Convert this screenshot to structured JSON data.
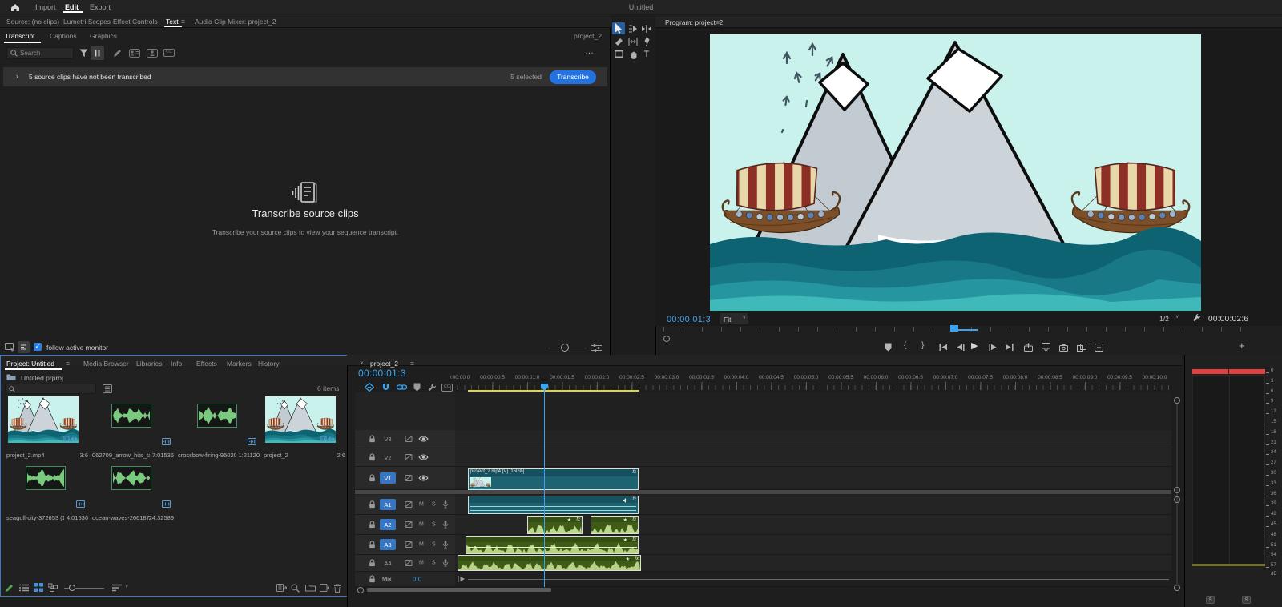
{
  "topbar": {
    "title": "Untitled",
    "tabs": [
      {
        "label": "Import",
        "active": false
      },
      {
        "label": "Edit",
        "active": true
      },
      {
        "label": "Export",
        "active": false
      }
    ]
  },
  "panel_tabs": [
    {
      "label": "Source: (no clips)",
      "active": false
    },
    {
      "label": "Lumetri Scopes",
      "active": false
    },
    {
      "label": "Effect Controls",
      "active": false
    },
    {
      "label": "Text",
      "active": true
    },
    {
      "label": "Audio Clip Mixer: project_2",
      "active": false
    }
  ],
  "text_panel": {
    "tabs": [
      {
        "label": "Transcript",
        "active": true
      },
      {
        "label": "Captions",
        "active": false
      },
      {
        "label": "Graphics",
        "active": false
      }
    ],
    "sequence_label": "project_2",
    "search_placeholder": "Search",
    "banner": {
      "message": "5 source clips have not been transcribed",
      "selected_count": "5 selected",
      "transcribe_button": "Transcribe"
    },
    "empty_state": {
      "title": "Transcribe source clips",
      "subtitle": "Transcribe your source clips to view your sequence transcript."
    },
    "footer": {
      "follow_label": "follow active monitor"
    }
  },
  "program_monitor": {
    "title": "Program: project_2",
    "playhead_timecode": "00:00:01:3",
    "zoom_select": "Fit",
    "playback_resolution": "1/2",
    "duration_timecode": "00:00:02:6"
  },
  "project_panel": {
    "tabs": [
      {
        "label": "Project: Untitled",
        "active": true
      },
      {
        "label": "Media Browser",
        "active": false
      },
      {
        "label": "Libraries",
        "active": false
      },
      {
        "label": "Info",
        "active": false
      },
      {
        "label": "Effects",
        "active": false
      },
      {
        "label": "Markers",
        "active": false
      },
      {
        "label": "History",
        "active": false
      }
    ],
    "bin_name": "Untitled.prproj",
    "items_count": "6 items",
    "clips": [
      {
        "name": "project_2.mp4",
        "duration": "3:6",
        "type": "video"
      },
      {
        "name": "062709_arrow_hits_ta..",
        "duration": "7:01536",
        "type": "audio"
      },
      {
        "name": "crossbow-firing-95020..",
        "duration": "1:21120",
        "type": "audio"
      },
      {
        "name": "project_2",
        "duration": "2:6",
        "type": "sequence"
      },
      {
        "name": "seagull-city-372653 (1)..",
        "duration": "4:01536",
        "type": "audio"
      },
      {
        "name": "ocean-waves-266187..",
        "duration": "24:32589",
        "type": "audio"
      }
    ]
  },
  "timeline": {
    "tab_label": "project_2",
    "playhead_timecode": "00:00:01:3",
    "ruler_labels": [
      "00:00:00:0",
      "00:00:00:5",
      "00:00:01:0",
      "00:00:01:5",
      "00:00:02:0",
      "00:00:02:5",
      "00:00:03:0",
      "00:00:03:5",
      "00:00:04:0",
      "00:00:04:5",
      "00:00:05:0",
      "00:00:05:5",
      "00:00:06:0",
      "00:00:06:5",
      "00:00:07:0",
      "00:00:07:5",
      "00:00:08:0",
      "00:00:08:5",
      "00:00:09:0",
      "00:00:09:5",
      "00:00:10:0"
    ],
    "video_tracks": [
      {
        "name": "V3",
        "targeted": false
      },
      {
        "name": "V2",
        "targeted": false
      },
      {
        "name": "V1",
        "targeted": true
      }
    ],
    "audio_tracks": [
      {
        "name": "A1",
        "targeted": true
      },
      {
        "name": "A2",
        "targeted": true
      },
      {
        "name": "A3",
        "targeted": true
      },
      {
        "name": "A4",
        "targeted": false
      }
    ],
    "mute_label": "M",
    "solo_label": "S",
    "mix": {
      "label": "Mix",
      "value": "0.0"
    },
    "clips": {
      "v1_label": "project_2.mp4 [V] [150%]",
      "fx_badge": "fx"
    }
  },
  "audio_meters": {
    "scale": [
      "0",
      "3",
      "6",
      "9",
      "12",
      "15",
      "18",
      "21",
      "24",
      "27",
      "30",
      "33",
      "36",
      "39",
      "42",
      "45",
      "48",
      "51",
      "54",
      "57"
    ],
    "db_label": "dB",
    "solo_label": "S"
  },
  "icons": {
    "menu": "≡",
    "more": "…",
    "close": "×",
    "chevron_right": "›",
    "caret_down": "∨",
    "cc": "CC",
    "type_tool": "T",
    "plus": "+",
    "play": "▶",
    "star": "★",
    "mark_in": "{",
    "mark_out": "}",
    "check": "✓"
  }
}
